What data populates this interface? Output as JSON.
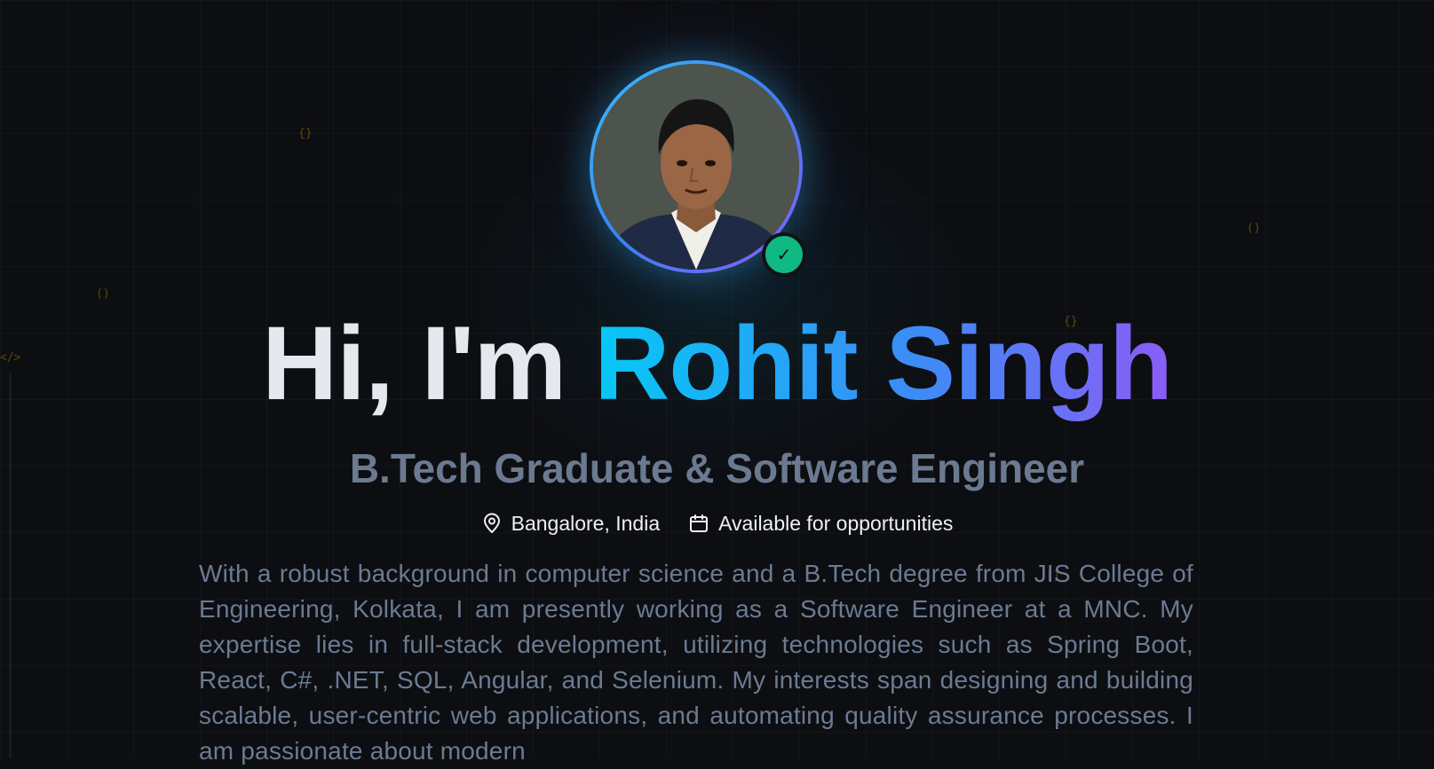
{
  "hero": {
    "greeting": "Hi, I'm",
    "name": "Rohit Singh",
    "subtitle": "B.Tech Graduate & Software Engineer"
  },
  "avatar": {
    "verified_mark": "✓"
  },
  "meta": {
    "location": "Bangalore, India",
    "availability": "Available for opportunities"
  },
  "bio": "With a robust background in computer science and a B.Tech degree from JIS College of Engineering, Kolkata, I am presently working as a Software Engineer at a MNC. My expertise lies in full-stack development, utilizing technologies such as Spring Boot, React, C#, .NET, SQL, Angular, and Selenium. My interests span designing and building scalable, user-centric web applications, and automating quality assurance processes. I am passionate about modern",
  "decorations": [
    "{}",
    "()",
    "</>",
    "()",
    "{}",
    "[]"
  ],
  "icons": {
    "location": "map-pin-icon",
    "availability": "calendar-icon",
    "verified": "check-icon"
  },
  "colors": {
    "background": "#0d0e12",
    "name_gradient_start": "#06c8f5",
    "name_gradient_mid": "#3b8df6",
    "name_gradient_end": "#8b5cf6",
    "subtitle": "#6b7a90",
    "verified_badge": "#10b981"
  }
}
